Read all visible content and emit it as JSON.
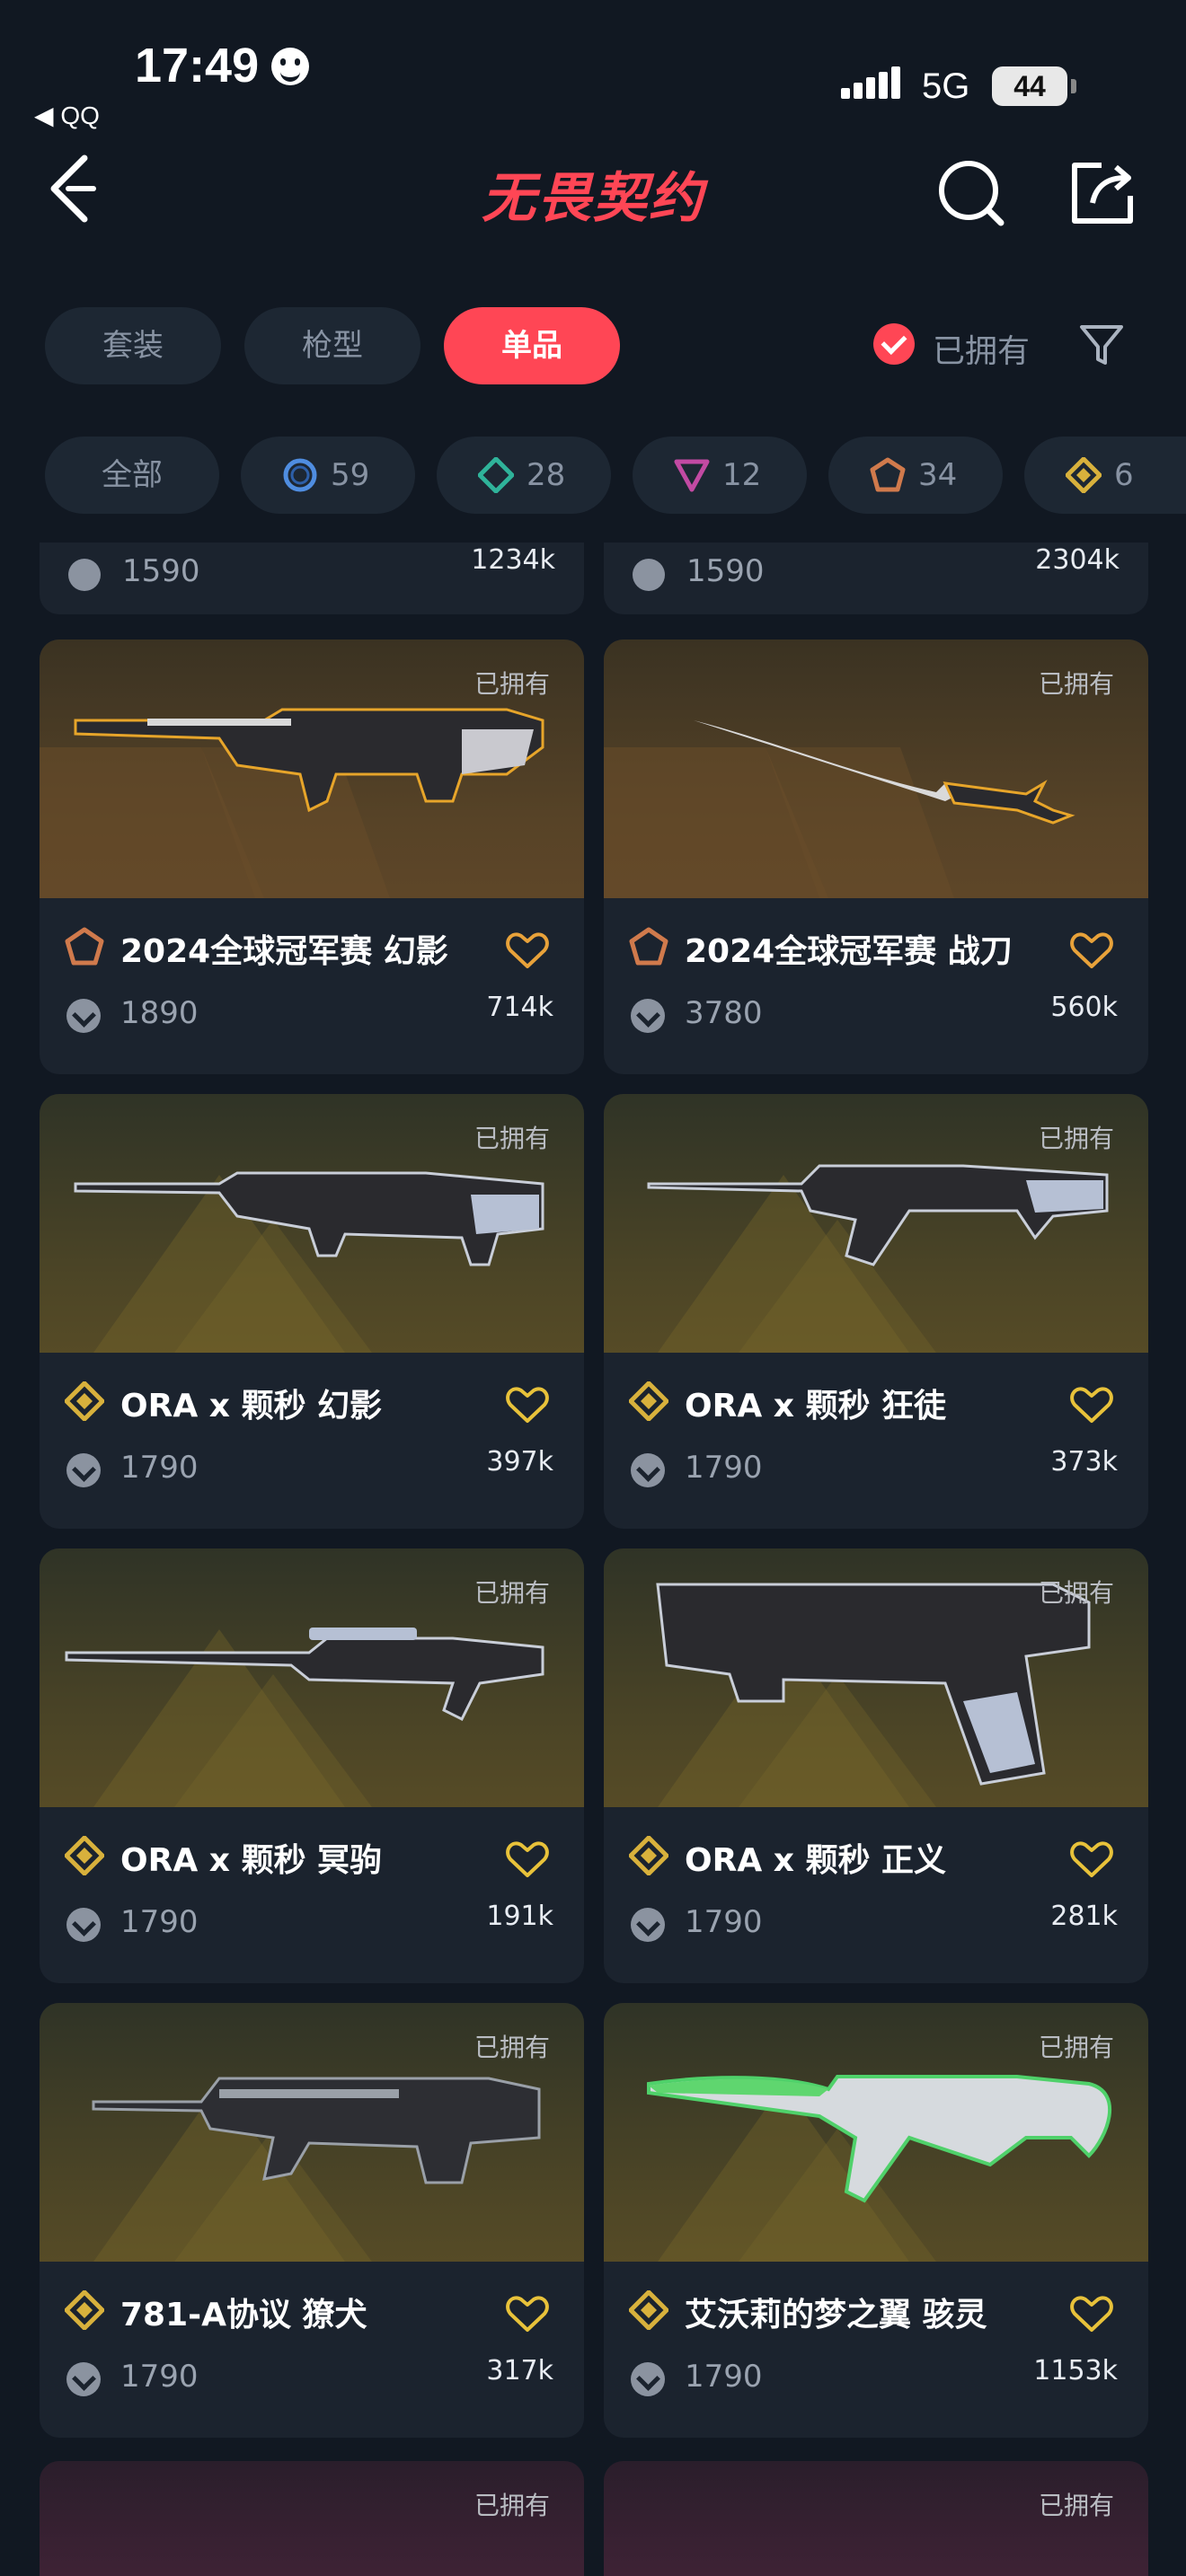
{
  "status_bar": {
    "time": "17:49",
    "back_app": "◀ QQ",
    "network": "5G",
    "battery": "44"
  },
  "nav": {
    "logo_text": "无畏契约"
  },
  "tabs": [
    {
      "label": "套装",
      "active": false
    },
    {
      "label": "枪型",
      "active": false
    },
    {
      "label": "单品",
      "active": true
    }
  ],
  "owned_filter": {
    "label": "已拥有",
    "checked": true
  },
  "tiers": [
    {
      "label": "全部"
    },
    {
      "count": "59",
      "tier": "select",
      "color": "#4f8de0"
    },
    {
      "count": "28",
      "tier": "deluxe",
      "color": "#2fb39a"
    },
    {
      "count": "12",
      "tier": "premium",
      "color": "#c24aa3"
    },
    {
      "count": "34",
      "tier": "exclusive",
      "color": "#d07a4c"
    },
    {
      "count": "6",
      "tier": "ultra",
      "color": "#d8b13c"
    }
  ],
  "partial_top": [
    {
      "price": "1590",
      "likes": "1234k"
    },
    {
      "price": "1590",
      "likes": "2304k"
    }
  ],
  "cards": [
    {
      "owned": "已拥有",
      "name": "2024全球冠军赛 幻影",
      "price": "1890",
      "likes": "714k",
      "tier": "exclusive"
    },
    {
      "owned": "已拥有",
      "name": "2024全球冠军赛 战刀",
      "price": "3780",
      "likes": "560k",
      "tier": "exclusive"
    },
    {
      "owned": "已拥有",
      "name": "ORA x 颗秒 幻影",
      "price": "1790",
      "likes": "397k",
      "tier": "ultra"
    },
    {
      "owned": "已拥有",
      "name": "ORA x 颗秒 狂徒",
      "price": "1790",
      "likes": "373k",
      "tier": "ultra"
    },
    {
      "owned": "已拥有",
      "name": "ORA x 颗秒 冥驹",
      "price": "1790",
      "likes": "191k",
      "tier": "ultra"
    },
    {
      "owned": "已拥有",
      "name": "ORA x 颗秒 正义",
      "price": "1790",
      "likes": "281k",
      "tier": "ultra"
    },
    {
      "owned": "已拥有",
      "name": "781-A协议 獠犬",
      "price": "1790",
      "likes": "317k",
      "tier": "ultra"
    },
    {
      "owned": "已拥有",
      "name": "艾沃莉的梦之翼 骇灵",
      "price": "1790",
      "likes": "1153k",
      "tier": "ultra"
    }
  ],
  "partial_bottom": [
    {
      "owned": "已拥有"
    },
    {
      "owned": "已拥有"
    }
  ],
  "icons": [
    "back-icon",
    "search-icon",
    "share-icon",
    "filter-icon",
    "heart-icon",
    "vp-coin-icon"
  ]
}
